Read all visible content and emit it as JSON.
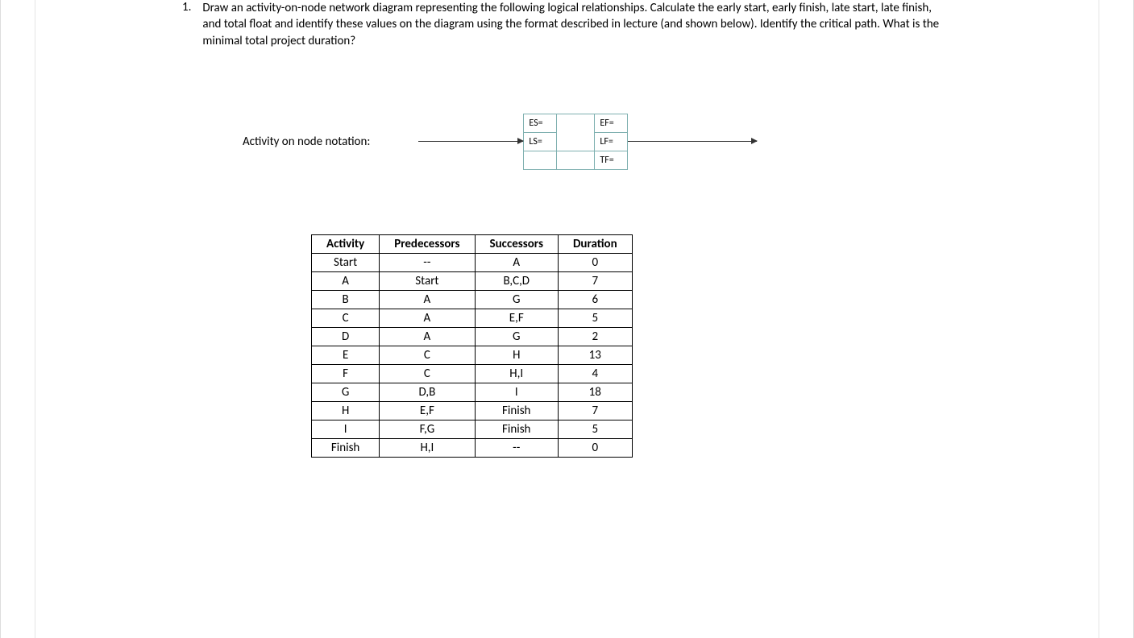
{
  "question": {
    "number": "1.",
    "text": "Draw an activity-on-node network diagram representing the following logical relationships. Calculate the early start, early finish, late start, late finish, and total float and identify these values on the diagram using the format described in lecture (and shown below). Identify the critical path. What is the minimal total project duration?"
  },
  "notation": {
    "label": "Activity on node notation:",
    "cells": {
      "es": "ES=",
      "ef": "EF=",
      "ls": "LS=",
      "lf": "LF=",
      "tf": "TF="
    }
  },
  "table": {
    "headers": [
      "Activity",
      "Predecessors",
      "Successors",
      "Duration"
    ],
    "rows": [
      [
        "Start",
        "--",
        "A",
        "0"
      ],
      [
        "A",
        "Start",
        "B,C,D",
        "7"
      ],
      [
        "B",
        "A",
        "G",
        "6"
      ],
      [
        "C",
        "A",
        "E,F",
        "5"
      ],
      [
        "D",
        "A",
        "G",
        "2"
      ],
      [
        "E",
        "C",
        "H",
        "13"
      ],
      [
        "F",
        "C",
        "H,I",
        "4"
      ],
      [
        "G",
        "D,B",
        "I",
        "18"
      ],
      [
        "H",
        "E,F",
        "Finish",
        "7"
      ],
      [
        "I",
        "F,G",
        "Finish",
        "5"
      ],
      [
        "Finish",
        "H,I",
        "--",
        "0"
      ]
    ]
  }
}
